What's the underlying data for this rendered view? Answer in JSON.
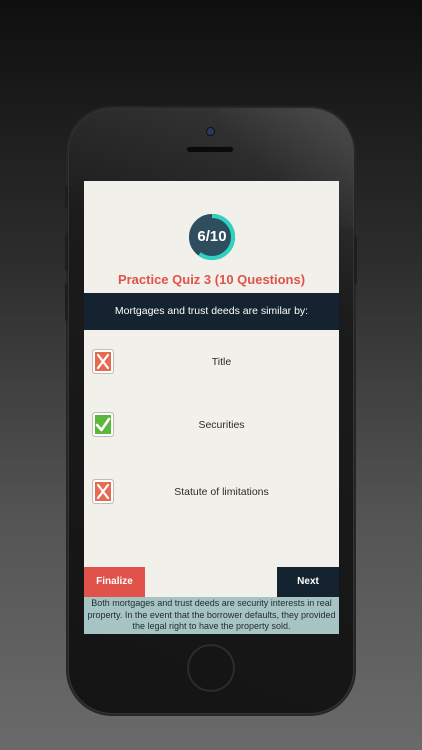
{
  "quiz": {
    "progress_text": "6/10",
    "progress_fraction": 0.6,
    "title": "Practice Quiz 3 (10 Questions)",
    "question": "Mortgages and trust deeds are similar by:",
    "answers": [
      {
        "label": "Title",
        "status": "wrong"
      },
      {
        "label": "Securities",
        "status": "correct"
      },
      {
        "label": "Statute of limitations",
        "status": "wrong"
      }
    ],
    "finalize_label": "Finalize",
    "next_label": "Next",
    "explanation": "Both mortgages and trust deeds are security interests in real property. In the event that the borrower defaults, they provided the legal right to have the property sold."
  },
  "icons": {
    "wrong": "x-mark-icon",
    "correct": "check-mark-icon"
  },
  "colors": {
    "accent_red": "#e0524a",
    "navy": "#14232f",
    "progress_teal": "#2ad4c0",
    "correct_green": "#5cb83a",
    "wrong_orange": "#e56b52",
    "explanation_bg": "#a7c4c5",
    "screen_bg": "#f2f0ea"
  }
}
